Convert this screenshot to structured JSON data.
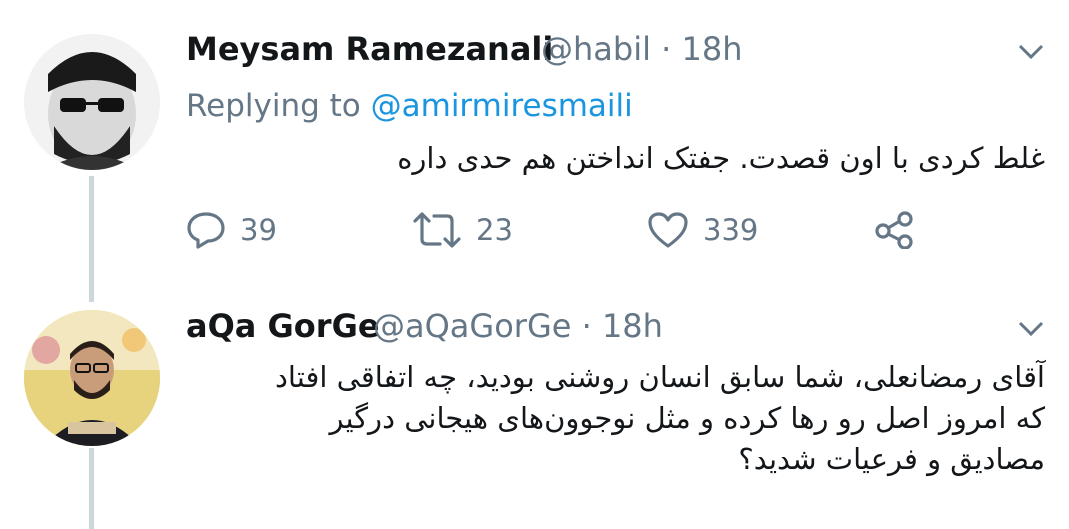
{
  "tweets": [
    {
      "name": "Meysam Ramezanali",
      "handle": "@habil",
      "time": "18h",
      "replying_prefix": "Replying to ",
      "replying_to": "@amirmiresmaili",
      "text": "غلط کردی با اون قصدت. جفتک انداختن هم حدی داره",
      "actions": {
        "reply_count": "39",
        "retweet_count": "23",
        "like_count": "339"
      }
    },
    {
      "name": "aQa GorGe",
      "handle": "@aQaGorGe",
      "time": "18h",
      "text_lines": [
        "آقای رمضانعلی، شما سابق انسان روشنی بودید، چه اتفاقی افتاد",
        "که امروز اصل رو رها کرده و مثل نوجوون‌های هیجانی درگیر",
        "مصادیق و فرعیات شدید؟"
      ]
    }
  ],
  "separator": " · ",
  "colors": {
    "text": "#14171a",
    "muted": "#657786",
    "link": "#1b95e0",
    "thread_line": "#ccd6dd"
  },
  "icons": [
    "reply-icon",
    "retweet-icon",
    "like-icon",
    "share-icon",
    "chevron-down-icon"
  ]
}
